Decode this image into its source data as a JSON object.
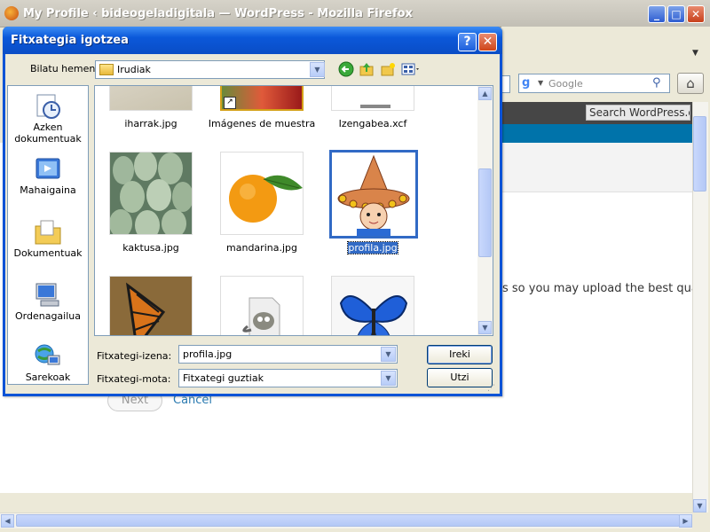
{
  "browser": {
    "title": "My Profile ‹ bideogeladigitala — WordPress - Mozilla Firefox",
    "window_buttons": {
      "minimize": "_",
      "maximize": "□",
      "close": "✕"
    },
    "search_placeholder": "Google",
    "home_icon": "⌂"
  },
  "page": {
    "wp_search_label": "Search WordPress.com",
    "upload_text": "s so you may upload the best qual",
    "next_button": "Next",
    "cancel_link": "Cancel"
  },
  "dialog": {
    "title": "Fitxategia igotzea",
    "help_button": "?",
    "close_button": "✕",
    "look_in_label": "Bilatu hemen:",
    "look_in_value": "Irudiak",
    "places": [
      {
        "label": "Azken dokumentuak",
        "icon": "recent-documents-icon"
      },
      {
        "label": "Mahaigaina",
        "icon": "desktop-icon"
      },
      {
        "label": "Dokumentuak",
        "icon": "documents-icon"
      },
      {
        "label": "Ordenagailua",
        "icon": "computer-icon"
      },
      {
        "label": "Sarekoak",
        "icon": "network-icon"
      }
    ],
    "files": [
      {
        "name": "iharrak.jpg",
        "thumb": "leaves"
      },
      {
        "name": "Imágenes de muestra",
        "thumb": "folder-shortcut"
      },
      {
        "name": "Izengabea.xcf",
        "thumb": "xcf"
      },
      {
        "name": "kaktusa.jpg",
        "thumb": "cactus"
      },
      {
        "name": "mandarina.jpg",
        "thumb": "tangerine"
      },
      {
        "name": "profila.jpg",
        "thumb": "sombrero-boy",
        "selected": true
      },
      {
        "name": "",
        "thumb": "monarch-butterfly"
      },
      {
        "name": "",
        "thumb": "gimp-file"
      },
      {
        "name": "",
        "thumb": "blue-butterfly"
      }
    ],
    "filename_label": "Fitxategi-izena:",
    "filename_value": "profila.jpg",
    "filetype_label": "Fitxategi-mota:",
    "filetype_value": "Fitxategi guztiak",
    "open_button": "Ireki",
    "cancel_button": "Utzi"
  },
  "colors": {
    "xp_blue": "#0a53d6",
    "selection": "#316ac5",
    "wp_admin": "#464646",
    "wp_blue": "#0073aa"
  }
}
